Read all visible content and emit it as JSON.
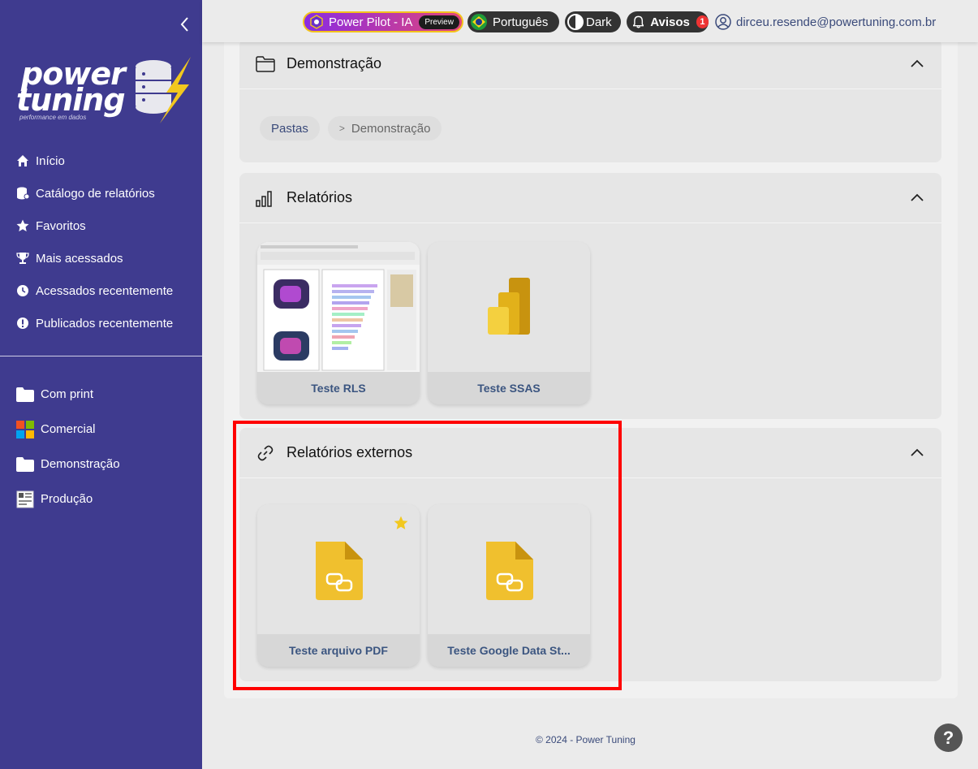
{
  "sidebar": {
    "logo_word1": "power",
    "logo_word2": "tuning",
    "logo_tagline": "performance em dados",
    "nav": [
      {
        "label": "Início",
        "icon": "home-icon"
      },
      {
        "label": "Catálogo de relatórios",
        "icon": "database-icon"
      },
      {
        "label": "Favoritos",
        "icon": "star-icon"
      },
      {
        "label": "Mais acessados",
        "icon": "trophy-icon"
      },
      {
        "label": "Acessados recentemente",
        "icon": "clock-icon"
      },
      {
        "label": "Publicados recentemente",
        "icon": "alert-icon"
      }
    ],
    "folders": [
      {
        "label": "Com print",
        "icon": "folder-icon"
      },
      {
        "label": "Comercial",
        "icon": "windows-grid-icon"
      },
      {
        "label": "Demonstração",
        "icon": "folder-icon"
      },
      {
        "label": "Produção",
        "icon": "production-icon"
      }
    ]
  },
  "topbar": {
    "pilot_label": "Power Pilot - IA",
    "pilot_badge": "Preview",
    "language": "Português",
    "theme": "Dark",
    "notices_label": "Avisos",
    "notices_count": "1",
    "user_email": "dirceu.resende@powertuning.com.br"
  },
  "folder_section": {
    "title": "Demonstração",
    "breadcrumb": [
      {
        "label": "Pastas"
      },
      {
        "separator": ">",
        "label": "Demonstração"
      }
    ]
  },
  "reports_section": {
    "title": "Relatórios",
    "cards": [
      {
        "label": "Teste RLS"
      },
      {
        "label": "Teste SSAS"
      }
    ]
  },
  "external_section": {
    "title": "Relatórios externos",
    "cards": [
      {
        "label": "Teste arquivo PDF",
        "favorite": true
      },
      {
        "label": "Teste Google Data St..."
      }
    ]
  },
  "footer": {
    "text": "© 2024 - Power Tuning"
  },
  "help": {
    "label": "?"
  },
  "colors": {
    "sidebar": "#3f3b8f",
    "highlight": "#ff0000",
    "link": "#3b5580"
  }
}
